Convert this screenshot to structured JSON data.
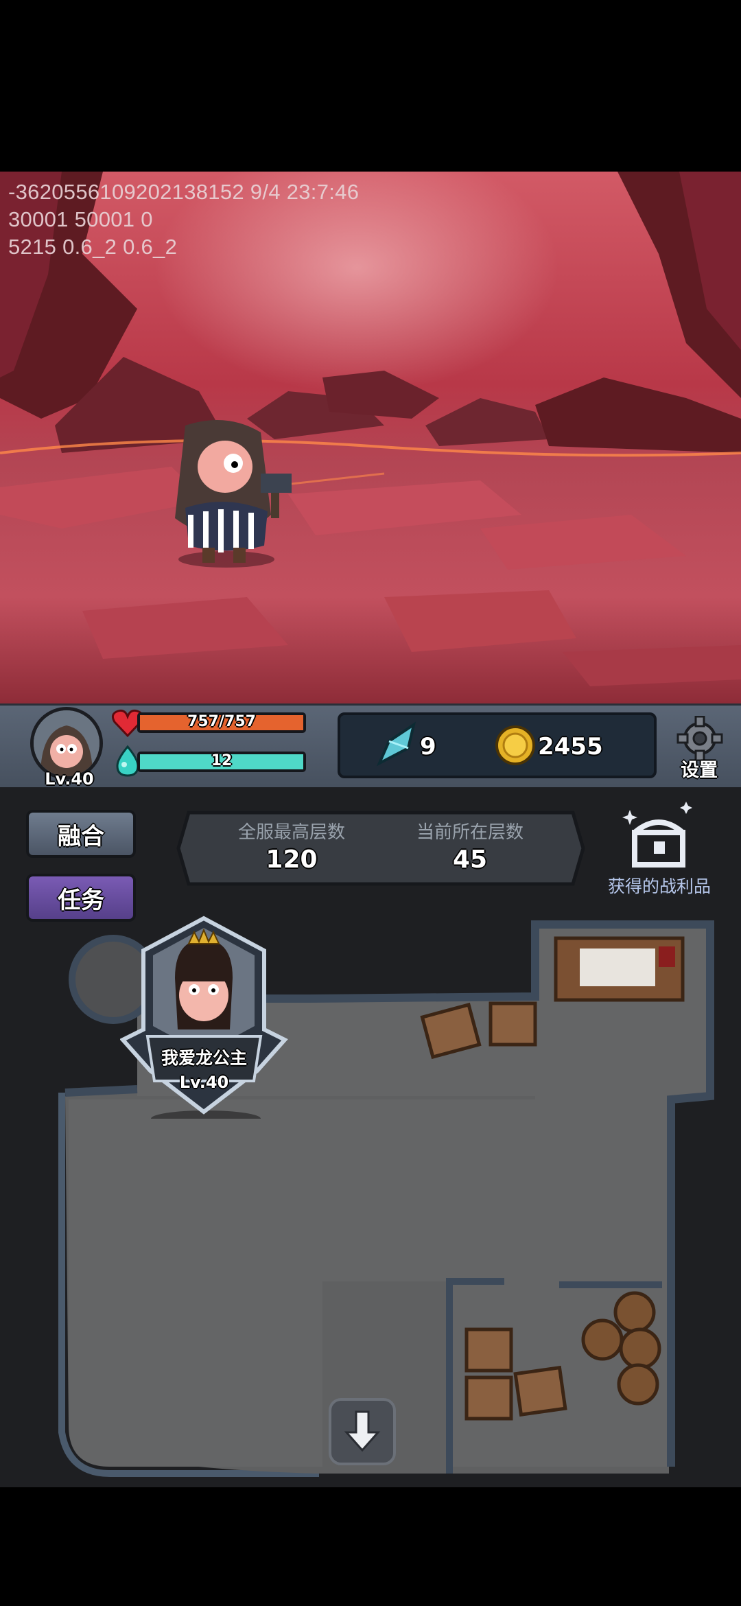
{
  "debug_lines": [
    "-3620556109202138152 9/4 23:7:46",
    "30001 50001 0",
    "5215 0.6_2 0.6_2"
  ],
  "player": {
    "level": "Lv.40",
    "hp": {
      "text": "757/757",
      "fraction": 1.0,
      "color": "#e5632e"
    },
    "mp": {
      "text": "12",
      "fraction": 1.0,
      "color": "#4fd9c8"
    }
  },
  "resources": {
    "crystal_count": "9",
    "gold_count": "2455"
  },
  "settings_label": "设置",
  "buttons": {
    "fusion": "融合",
    "quest": "任务"
  },
  "floors": {
    "server_best_label": "全服最高层数",
    "server_best_value": "120",
    "current_label": "当前所在层数",
    "current_value": "45"
  },
  "loot_label": "获得的战利品",
  "hero_card": {
    "name": "我爱龙公主",
    "level": "Lv.40"
  },
  "icons": [
    "heart-icon",
    "mana-drop-icon",
    "crystal-icon",
    "gold-coin-icon",
    "gear-icon",
    "treasure-chest-icon",
    "down-arrow-icon"
  ]
}
